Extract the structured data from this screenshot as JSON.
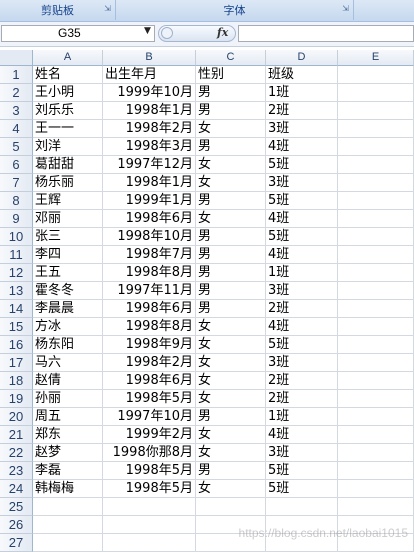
{
  "ribbon": {
    "groups": [
      "剪贴板",
      "字体",
      ""
    ]
  },
  "formula_bar": {
    "name_box": "G35",
    "fx_label": "fx",
    "formula": ""
  },
  "columns": [
    "A",
    "B",
    "C",
    "D",
    "E"
  ],
  "rows": [
    [
      "1",
      "姓名",
      "出生年月",
      "性别",
      "班级"
    ],
    [
      "2",
      "王小明",
      "1999年10月",
      "男",
      "1班"
    ],
    [
      "3",
      "刘乐乐",
      "1998年1月",
      "男",
      "2班"
    ],
    [
      "4",
      "王一一",
      "1998年2月",
      "女",
      "3班"
    ],
    [
      "5",
      "刘洋",
      "1998年3月",
      "男",
      "4班"
    ],
    [
      "6",
      "葛甜甜",
      "1997年12月",
      "女",
      "5班"
    ],
    [
      "7",
      "杨乐丽",
      "1998年1月",
      "女",
      "3班"
    ],
    [
      "8",
      "王辉",
      "1999年1月",
      "男",
      "5班"
    ],
    [
      "9",
      "邓丽",
      "1998年6月",
      "女",
      "4班"
    ],
    [
      "10",
      "张三",
      "1998年10月",
      "男",
      "5班"
    ],
    [
      "11",
      "李四",
      "1998年7月",
      "男",
      "4班"
    ],
    [
      "12",
      "王五",
      "1998年8月",
      "男",
      "1班"
    ],
    [
      "13",
      "霍冬冬",
      "1997年11月",
      "男",
      "3班"
    ],
    [
      "14",
      "李晨晨",
      "1998年6月",
      "男",
      "2班"
    ],
    [
      "15",
      "方冰",
      "1998年8月",
      "女",
      "4班"
    ],
    [
      "16",
      "杨东阳",
      "1998年9月",
      "女",
      "5班"
    ],
    [
      "17",
      "马六",
      "1998年2月",
      "女",
      "3班"
    ],
    [
      "18",
      "赵倩",
      "1998年6月",
      "女",
      "2班"
    ],
    [
      "19",
      "孙丽",
      "1998年5月",
      "女",
      "2班"
    ],
    [
      "20",
      "周五",
      "1997年10月",
      "男",
      "1班"
    ],
    [
      "21",
      "郑东",
      "1999年2月",
      "女",
      "4班"
    ],
    [
      "22",
      "赵梦",
      "1998你那8月",
      "女",
      "3班"
    ],
    [
      "23",
      "李磊",
      "1998年5月",
      "男",
      "5班"
    ],
    [
      "24",
      "韩梅梅",
      "1998年5月",
      "女",
      "5班"
    ],
    [
      "25",
      "",
      "",
      "",
      ""
    ],
    [
      "26",
      "",
      "",
      "",
      ""
    ],
    [
      "27",
      "",
      "",
      "",
      ""
    ]
  ],
  "watermark": "https://blog.csdn.net/laobai1015"
}
